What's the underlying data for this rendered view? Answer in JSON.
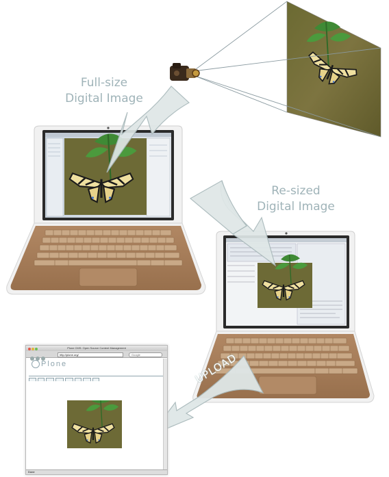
{
  "captions": {
    "full_size_line1": "Full-size",
    "full_size_line2": "Digital Image",
    "resized_line1": "Re-sized",
    "resized_line2": "Digital Image",
    "upload": "UPLOAD"
  },
  "browser": {
    "window_title": "Plone CMS: Open Source Content Management",
    "address": "http://plone.org/",
    "search_placeholder": "Google",
    "logo_text": "Plone",
    "status": "Done"
  },
  "colors": {
    "laptop_body": "#a67d5a",
    "laptop_screen_bezel": "#2a2a2a",
    "arrow_fill": "#dfe7e7",
    "arrow_stroke": "#a9b9bb",
    "caption_text": "#9fb3b8"
  }
}
